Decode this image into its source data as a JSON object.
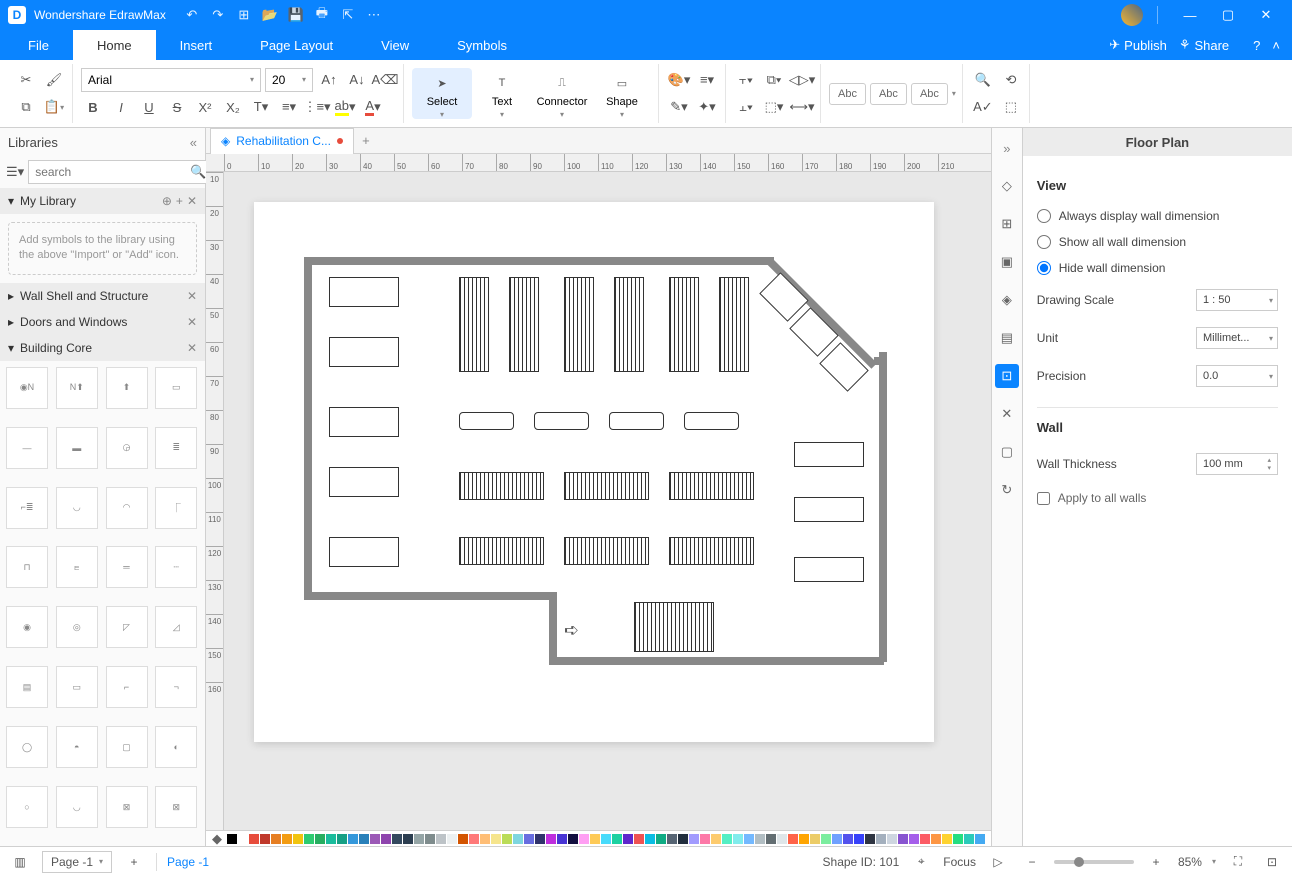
{
  "app": {
    "name": "Wondershare EdrawMax"
  },
  "menu": {
    "file": "File",
    "home": "Home",
    "insert": "Insert",
    "pageLayout": "Page Layout",
    "view": "View",
    "symbols": "Symbols",
    "publish": "Publish",
    "share": "Share"
  },
  "ribbon": {
    "font": "Arial",
    "size": "20",
    "select": "Select",
    "text": "Text",
    "connector": "Connector",
    "shape": "Shape",
    "themeBtns": [
      "Abc",
      "Abc",
      "Abc"
    ]
  },
  "leftPanel": {
    "title": "Libraries",
    "searchPlaceholder": "search",
    "sections": {
      "myLibrary": "My Library",
      "wall": "Wall Shell and Structure",
      "doors": "Doors and Windows",
      "core": "Building Core"
    },
    "hint": "Add symbols to the library using the above \"Import\" or \"Add\" icon."
  },
  "document": {
    "tabName": "Rehabilitation C..."
  },
  "rightPanel": {
    "title": "Floor Plan",
    "viewTitle": "View",
    "radios": {
      "always": "Always display wall dimension",
      "showAll": "Show all wall dimension",
      "hide": "Hide wall dimension"
    },
    "drawingScale": {
      "label": "Drawing Scale",
      "value": "1 : 50"
    },
    "unit": {
      "label": "Unit",
      "value": "Millimet..."
    },
    "precision": {
      "label": "Precision",
      "value": "0.0"
    },
    "wallTitle": "Wall",
    "wallThickness": {
      "label": "Wall Thickness",
      "value": "100 mm"
    },
    "applyAll": "Apply to all walls"
  },
  "status": {
    "pageSelect": "Page -1",
    "pageLabel": "Page -1",
    "shapeId": "Shape ID: 101",
    "focus": "Focus",
    "zoom": "85%"
  },
  "ruler": {
    "h": [
      "0",
      "10",
      "20",
      "30",
      "40",
      "50",
      "60",
      "70",
      "80",
      "90",
      "100",
      "110",
      "120",
      "130",
      "140",
      "150",
      "160",
      "170",
      "180",
      "190",
      "200",
      "210"
    ],
    "v": [
      "10",
      "20",
      "30",
      "40",
      "50",
      "60",
      "70",
      "80",
      "90",
      "100",
      "110",
      "120",
      "130",
      "140",
      "150",
      "160"
    ]
  },
  "colors": [
    "#000000",
    "#ffffff",
    "#e74c3c",
    "#c0392b",
    "#e67e22",
    "#f39c12",
    "#f1c40f",
    "#2ecc71",
    "#27ae60",
    "#1abc9c",
    "#16a085",
    "#3498db",
    "#2980b9",
    "#9b59b6",
    "#8e44ad",
    "#34495e",
    "#2c3e50",
    "#95a5a6",
    "#7f8c8d",
    "#bdc3c7",
    "#ecf0f1",
    "#d35400",
    "#ff7979",
    "#ffbe76",
    "#f6e58d",
    "#badc58",
    "#7ed6df",
    "#686de0",
    "#30336b",
    "#be2edd",
    "#4834d4",
    "#130f40",
    "#ff9ff3",
    "#feca57",
    "#48dbfb",
    "#1dd1a1",
    "#5f27cd",
    "#ee5253",
    "#0abde3",
    "#10ac84",
    "#576574",
    "#222f3e",
    "#a29bfe",
    "#fd79a8",
    "#fdcb6e",
    "#55efc4",
    "#81ecec",
    "#74b9ff",
    "#b2bec3",
    "#636e72",
    "#dfe6e9",
    "#ff6348",
    "#ffa502",
    "#eccc68",
    "#7bed9f",
    "#70a1ff",
    "#5352ed",
    "#3742fa",
    "#2f3542",
    "#a4b0be",
    "#ced6e0",
    "#8854d0",
    "#a55eea",
    "#fc5c65",
    "#fd9644",
    "#fed330",
    "#26de81",
    "#2bcbba",
    "#45aaf2"
  ]
}
